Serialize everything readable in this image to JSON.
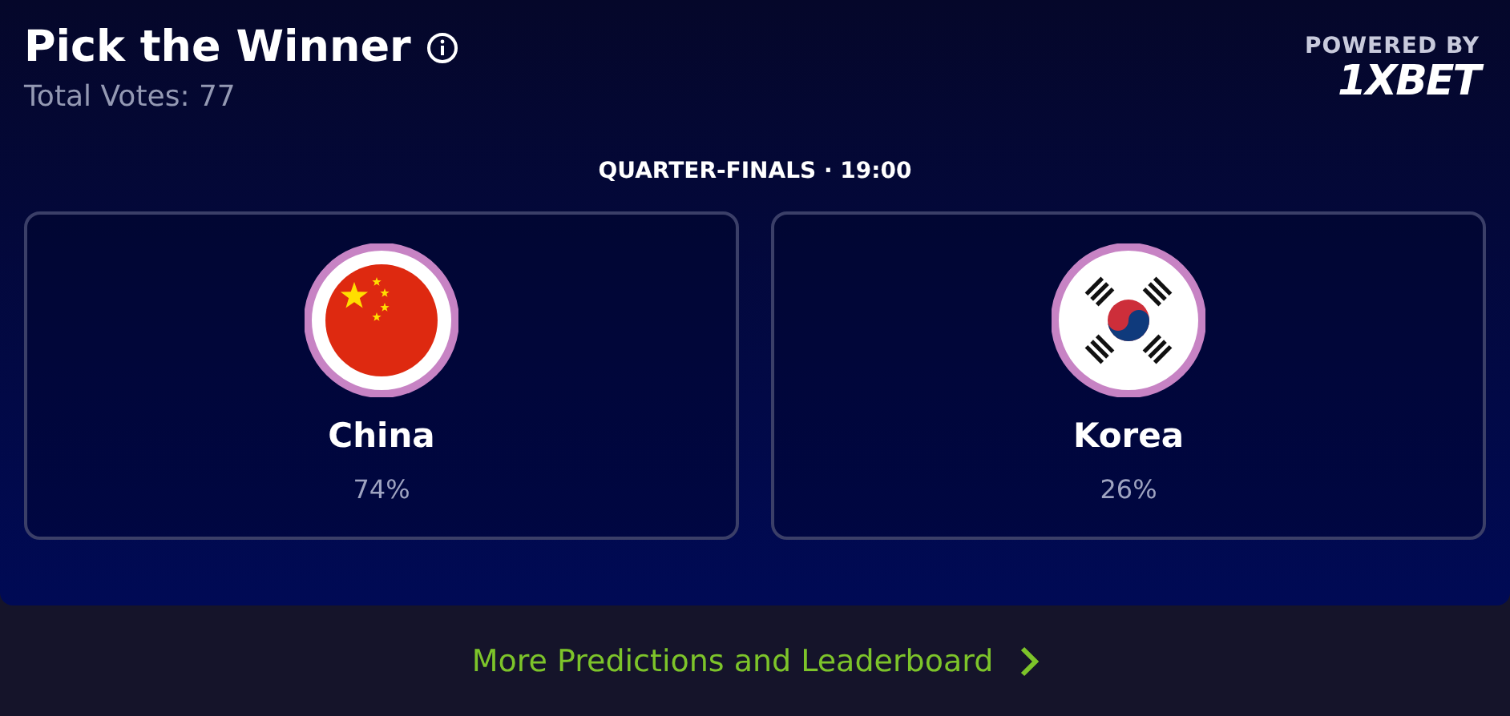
{
  "header": {
    "title": "Pick the Winner",
    "total_votes": "Total Votes: 77",
    "powered_by": "POWERED BY",
    "brand": "1XBET"
  },
  "match": {
    "stage": "QUARTER-FINALS · 19:00"
  },
  "teams": [
    {
      "name": "China",
      "percent": "74%",
      "kind": "china"
    },
    {
      "name": "Korea",
      "percent": "26%",
      "kind": "korea"
    }
  ],
  "footer": {
    "link": "More Predictions and Leaderboard"
  }
}
